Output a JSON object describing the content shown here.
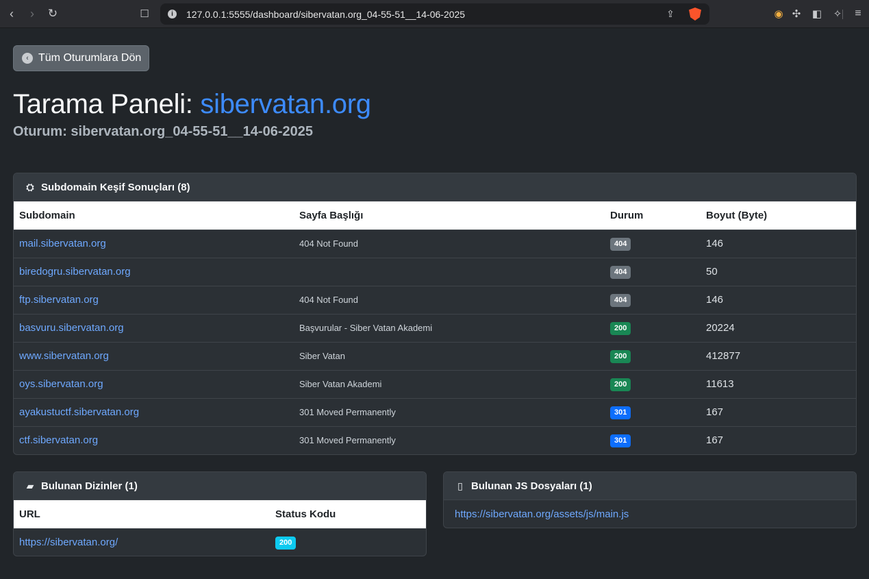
{
  "browser": {
    "url": "127.0.0.1:5555/dashboard/sibervatan.org_04-55-51__14-06-2025"
  },
  "back_button": {
    "label": "Tüm Oturumlara Dön"
  },
  "header": {
    "title_prefix": "Tarama Paneli: ",
    "title_domain": "sibervatan.org",
    "session": "Oturum: sibervatan.org_04-55-51__14-06-2025"
  },
  "subdomains": {
    "heading": "Subdomain Keşif Sonuçları (8)",
    "columns": [
      "Subdomain",
      "Sayfa Başlığı",
      "Durum",
      "Boyut (Byte)"
    ],
    "rows": [
      {
        "subdomain": "mail.sibervatan.org",
        "title": "404 Not Found",
        "status": "404",
        "size": "146"
      },
      {
        "subdomain": "biredogru.sibervatan.org",
        "title": "",
        "status": "404",
        "size": "50"
      },
      {
        "subdomain": "ftp.sibervatan.org",
        "title": "404 Not Found",
        "status": "404",
        "size": "146"
      },
      {
        "subdomain": "basvuru.sibervatan.org",
        "title": "Başvurular - Siber Vatan Akademi",
        "status": "200",
        "size": "20224"
      },
      {
        "subdomain": "www.sibervatan.org",
        "title": "Siber Vatan",
        "status": "200",
        "size": "412877"
      },
      {
        "subdomain": "oys.sibervatan.org",
        "title": "Siber Vatan Akademi",
        "status": "200",
        "size": "11613"
      },
      {
        "subdomain": "ayakustuctf.sibervatan.org",
        "title": "301 Moved Permanently",
        "status": "301",
        "size": "167"
      },
      {
        "subdomain": "ctf.sibervatan.org",
        "title": "301 Moved Permanently",
        "status": "301",
        "size": "167"
      }
    ]
  },
  "directories": {
    "heading": "Bulunan Dizinler (1)",
    "columns": [
      "URL",
      "Status Kodu"
    ],
    "rows": [
      {
        "url": "https://sibervatan.org/",
        "status": "200"
      }
    ]
  },
  "js_files": {
    "heading": "Bulunan JS Dosyaları (1)",
    "items": [
      "https://sibervatan.org/assets/js/main.js"
    ]
  },
  "colors": {
    "accent": "#3d8bfd",
    "status_404": "#6c757d",
    "status_200": "#198754",
    "status_301": "#0d6efd",
    "dir_status": "#0dcaf0"
  }
}
